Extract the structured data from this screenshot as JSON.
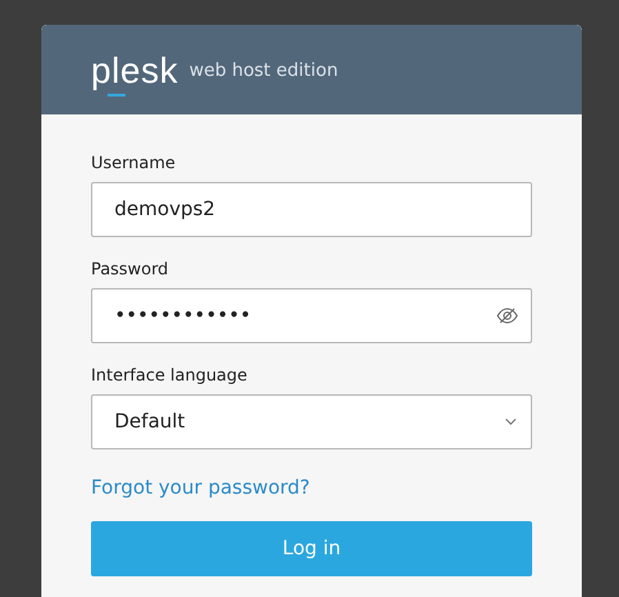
{
  "header": {
    "logo": "plesk",
    "edition": "web host edition"
  },
  "fields": [
    {
      "kind": "text",
      "label": "Username",
      "value": "demovps2"
    },
    {
      "kind": "password",
      "label": "Password",
      "value": "••••••••••••"
    },
    {
      "kind": "select",
      "label": "Interface language",
      "value": "Default"
    }
  ],
  "forgot_link": "Forgot your password?",
  "login_button": "Log in"
}
